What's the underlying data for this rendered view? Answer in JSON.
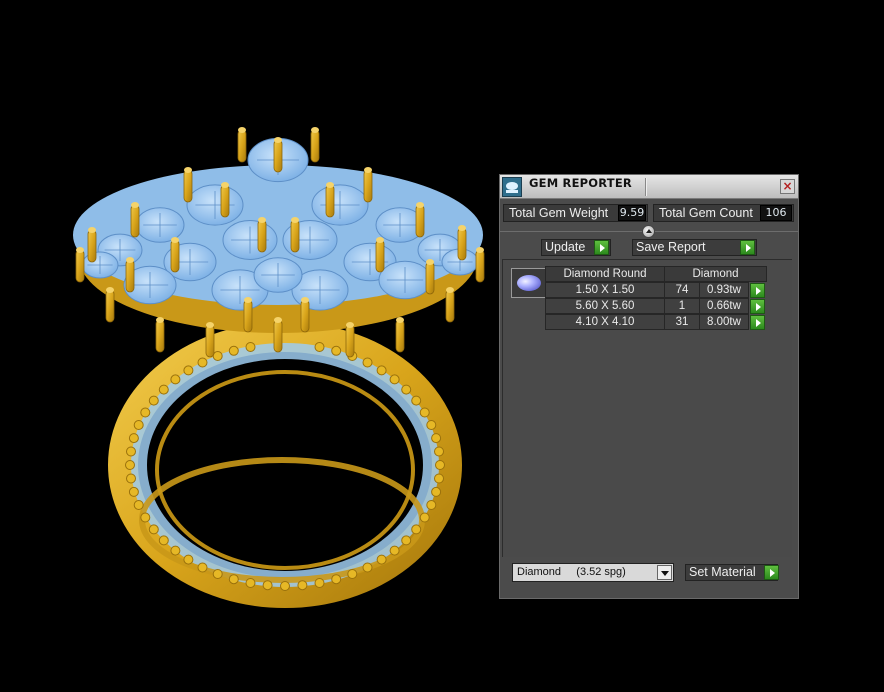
{
  "window": {
    "title": "GEM REPORTER",
    "close_glyph": "×"
  },
  "totals": {
    "weight_label": "Total Gem Weight",
    "weight_value": "9.59",
    "count_label": "Total Gem Count",
    "count_value": "106"
  },
  "actions": {
    "update_label": "Update",
    "save_label": "Save Report",
    "set_material_label": "Set Material"
  },
  "table": {
    "shape_header": "Diamond Round",
    "material_header": "Diamond",
    "rows": [
      {
        "size": "1.50 X 1.50",
        "count": "74",
        "weight": "0.93tw"
      },
      {
        "size": "5.60 X 5.60",
        "count": "1",
        "weight": "0.66tw"
      },
      {
        "size": "4.10 X 4.10",
        "count": "31",
        "weight": "8.00tw"
      }
    ]
  },
  "material_select": {
    "selected": "Diamond     (3.52 spg)"
  },
  "icons": {
    "title": "gem-reporter-icon",
    "thumb": "round-diamond-icon",
    "go": "green-arrow-icon"
  },
  "colors": {
    "metal": "#e3b422",
    "gem": "#9ecbf0",
    "panel_bg": "#4b4b4b",
    "go_button": "#3faa2a"
  }
}
